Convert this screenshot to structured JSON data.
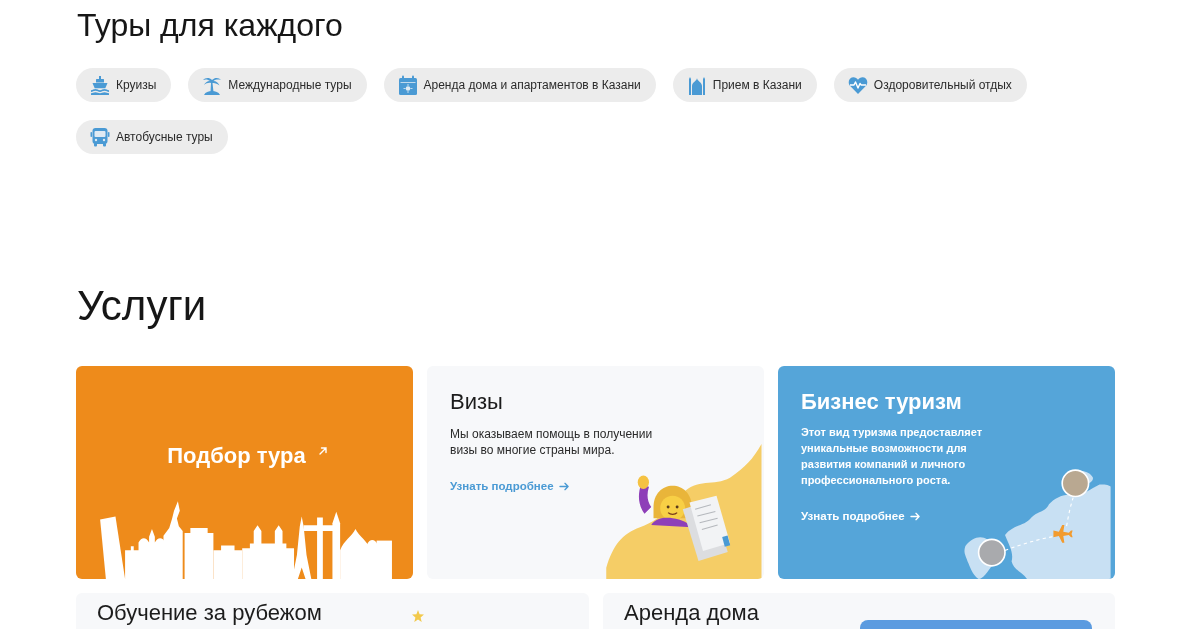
{
  "tours": {
    "title": "Туры для каждого",
    "categories": [
      {
        "kind": "cruise",
        "label": "Круизы"
      },
      {
        "kind": "palm",
        "label": "Международные туры"
      },
      {
        "kind": "calendar",
        "label": "Аренда дома и апартаментов в Казани"
      },
      {
        "kind": "mosque",
        "label": "Прием в Казани"
      },
      {
        "kind": "health",
        "label": "Оздоровительный отдых"
      },
      {
        "kind": "bus",
        "label": "Автобусные туры"
      }
    ]
  },
  "services": {
    "title": "Услуги",
    "cards": [
      {
        "kind": "picker",
        "title": "Подбор тура"
      },
      {
        "kind": "visa",
        "title": "Визы",
        "text": "Мы оказываем помощь в получении визы во многие страны мира.",
        "link": "Узнать подробнее"
      },
      {
        "kind": "business",
        "title": "Бизнес туризм",
        "text": "Этот вид туризма предоставляет уникальные возможности для развития компаний и личного профессионального роста.",
        "link": "Узнать подробнее"
      }
    ],
    "more_cards": [
      {
        "kind": "study",
        "title": "Обучение за рубежом"
      },
      {
        "kind": "rental",
        "title": "Аренда дома"
      }
    ]
  }
}
